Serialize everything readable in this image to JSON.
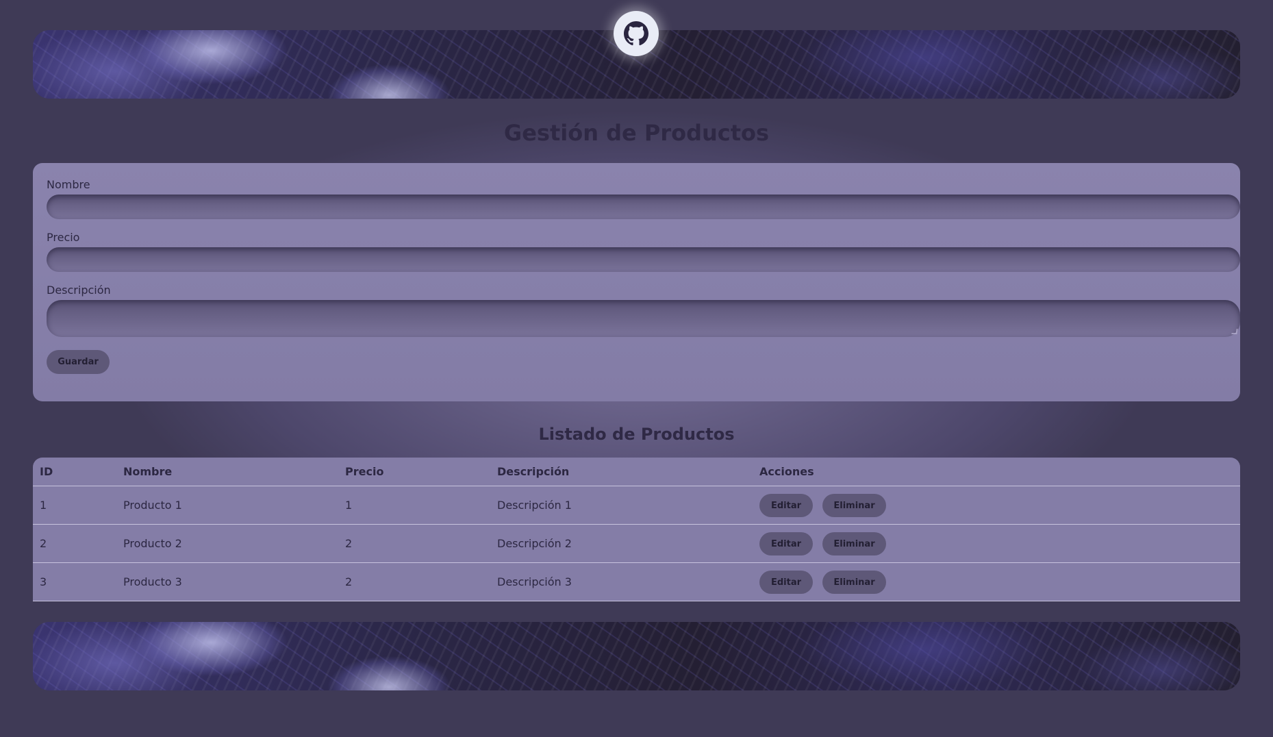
{
  "header": {
    "github_icon": "github-icon"
  },
  "page_title": "Gestión de Productos",
  "form": {
    "name_label": "Nombre",
    "price_label": "Precio",
    "description_label": "Descripción",
    "name_value": "",
    "price_value": "",
    "description_value": "",
    "save_label": "Guardar"
  },
  "list_title": "Listado de Productos",
  "table": {
    "headers": {
      "id": "ID",
      "nombre": "Nombre",
      "precio": "Precio",
      "descripcion": "Descripción",
      "acciones": "Acciones"
    },
    "rows": [
      {
        "id": "1",
        "nombre": "Producto 1",
        "precio": "1",
        "descripcion": "Descripción 1",
        "edit": "Editar",
        "delete": "Eliminar"
      },
      {
        "id": "2",
        "nombre": "Producto 2",
        "precio": "2",
        "descripcion": "Descripción 2",
        "edit": "Editar",
        "delete": "Eliminar"
      },
      {
        "id": "3",
        "nombre": "Producto 3",
        "precio": "2",
        "descripcion": "Descripción 3",
        "edit": "Editar",
        "delete": "Eliminar"
      }
    ]
  },
  "colors": {
    "background": "#3f3a56",
    "card": "#867fa9",
    "button": "#5e5878",
    "text": "#2c2742"
  }
}
